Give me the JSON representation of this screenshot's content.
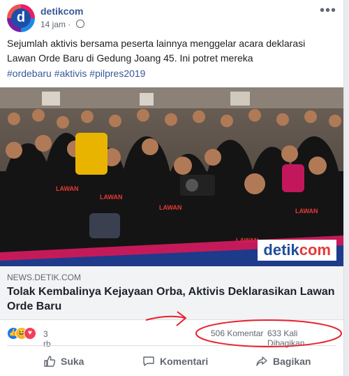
{
  "post": {
    "page_name": "detikcom",
    "avatar_letter": "d",
    "time": "14 jam",
    "more": "•••",
    "text": "Sejumlah aktivis bersama peserta lainnya menggelar acara deklarasi Lawan Orde Baru di Gedung Joang 45. Ini potret mereka",
    "hashtags": "#ordebaru #aktivis #pilpres2019"
  },
  "photo": {
    "brand_part1": "detik",
    "brand_part2": "com",
    "sign_text": "LAWAN"
  },
  "link": {
    "domain": "NEWS.DETIK.COM",
    "title": "Tolak Kembalinya Kejayaan Orba, Aktivis Deklarasikan Lawan Orde Baru"
  },
  "stats": {
    "reactions_count": "3 rb",
    "comments": "506 Komentar",
    "shares": "633 Kali Dibagikan"
  },
  "actions": {
    "like": "Suka",
    "comment": "Komentari",
    "share": "Bagikan"
  },
  "colors": {
    "link_blue": "#385898",
    "annotation_red": "#e8232e",
    "like_blue": "#1877f2",
    "haha_yellow": "#f7b125",
    "love_red": "#f33e58"
  },
  "icons": {
    "globe": "globe-icon",
    "like": "like-icon",
    "comment": "comment-icon",
    "share": "share-icon"
  }
}
